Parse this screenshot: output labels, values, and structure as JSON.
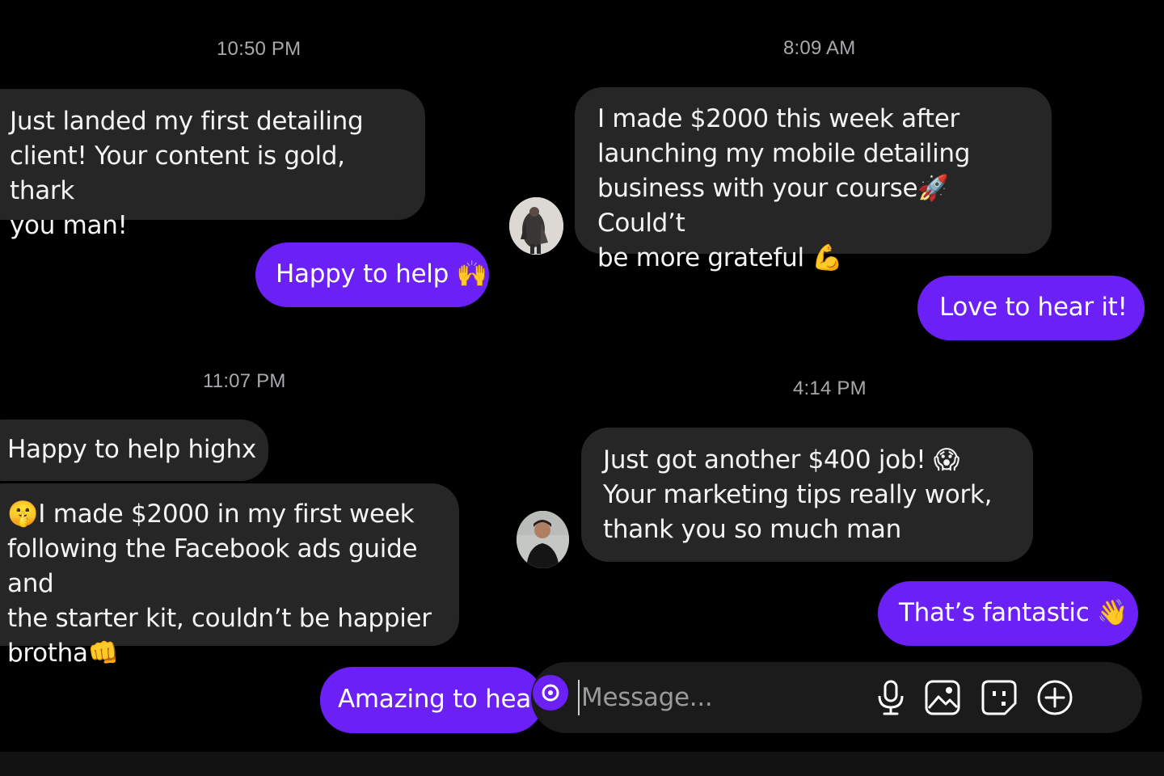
{
  "colors": {
    "background": "#000000",
    "incoming_bubble": "#262626",
    "outgoing_bubble": "#6b20f5",
    "timestamp": "#a9a9ad"
  },
  "left_thread": {
    "timestamp_1": "10:50 PM",
    "msg_1": "Just landed my first detailing\nclient! Your content is gold, thark\nyou man!",
    "reply_1": "Happy to help 🙌",
    "timestamp_2": "11:07 PM",
    "msg_2": "Happy to help highx",
    "msg_3": "🤫I made $2000 in my first week\nfollowing the Facebook ads guide and\nthe starter kit, couldn’t be happier\nbrotha👊",
    "reply_2": "Amazing to hear"
  },
  "right_thread": {
    "timestamp_1": "8:09 AM",
    "msg_1": "I made $2000 this week after\nlaunching my mobile detailing\nbusiness with your course🚀 Could’t\nbe more grateful 💪",
    "reply_1": "Love to hear it!",
    "timestamp_2": "4:14 PM",
    "msg_2": "Just got another $400 job! 😱\nYour marketing tips really work,\nthank you so much man",
    "reply_2": "That’s fantastic 👋"
  },
  "composer": {
    "placeholder": "Message...",
    "icons": [
      "camera-icon",
      "microphone-icon",
      "image-icon",
      "sticker-icon",
      "add-icon"
    ]
  }
}
